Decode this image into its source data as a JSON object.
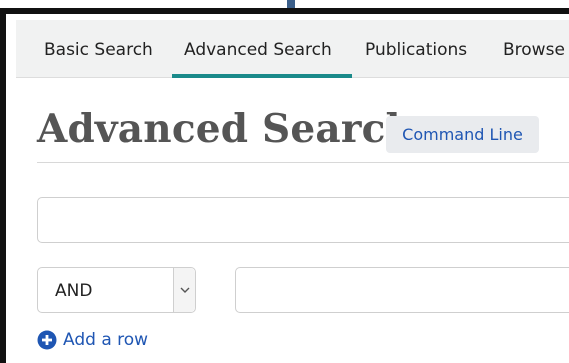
{
  "nav": {
    "items": [
      {
        "label": "Basic Search"
      },
      {
        "label": "Advanced Search"
      },
      {
        "label": "Publications"
      },
      {
        "label": "Browse"
      }
    ],
    "active_index": 1
  },
  "page": {
    "title": "Advanced Search",
    "command_line_label": "Command Line"
  },
  "query": {
    "row1_value": "",
    "row2_operator": "AND",
    "row2_value": ""
  },
  "actions": {
    "add_row_label": "Add a row",
    "add_row_icon": "plus-circle-icon"
  },
  "colors": {
    "accent_teal": "#1a8a8a",
    "link_blue": "#1f56b3",
    "nav_bg": "#f1f2f2"
  }
}
